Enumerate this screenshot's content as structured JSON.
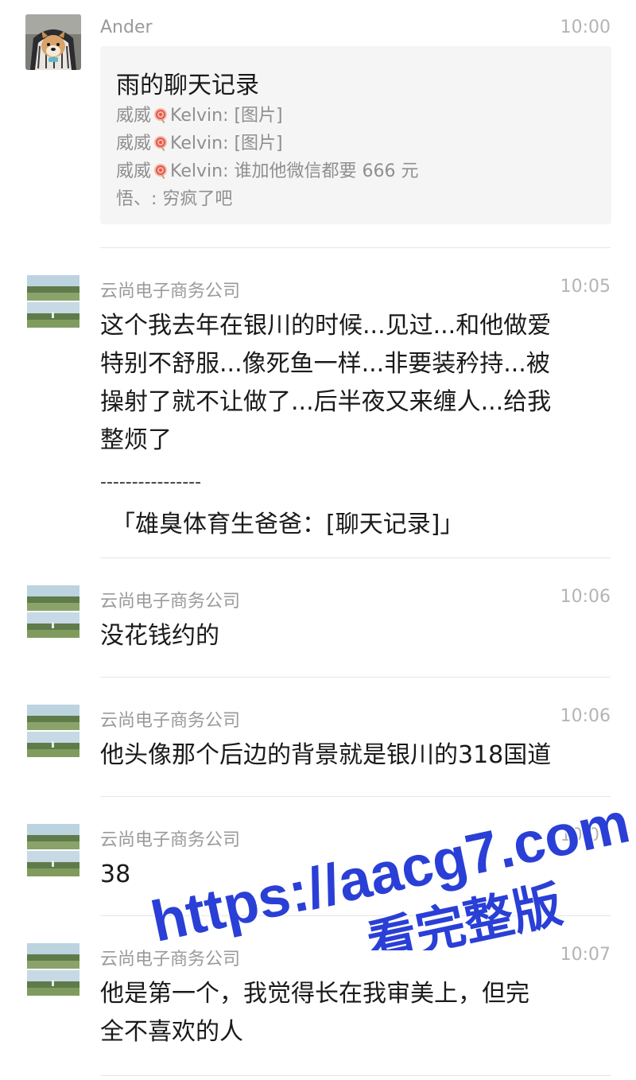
{
  "messages": [
    {
      "sender": "Ander",
      "time": "10:00",
      "avatar": "shiba-dog-avatar",
      "chat_record": {
        "title": "雨的聊天记录",
        "lines": [
          {
            "name": "威威",
            "rest": "Kelvin: [图片]"
          },
          {
            "name": "威威",
            "rest": "Kelvin: [图片]"
          },
          {
            "name": "威威",
            "rest": "Kelvin: 谁加他微信都要 666 元"
          },
          {
            "text": "悟、: 穷疯了吧"
          }
        ]
      }
    },
    {
      "sender": "云尚电子商务公司",
      "time": "10:05",
      "avatar": "landscape-avatar",
      "lines": [
        "这个我去年在银川的时候...见过...和他做爱",
        "特别不舒服...像死鱼一样...非要装矜持...被",
        "操射了就不让做了...后半夜又来缠人...给我",
        "整烦了"
      ],
      "separator": "----------------",
      "quote": "「雄臭体育生爸爸：[聊天记录]」"
    },
    {
      "sender": "云尚电子商务公司",
      "time": "10:06",
      "avatar": "landscape-avatar",
      "lines": [
        "没花钱约的"
      ]
    },
    {
      "sender": "云尚电子商务公司",
      "time": "10:06",
      "avatar": "landscape-avatar",
      "lines": [
        "他头像那个后边的背景就是银川的318国道"
      ]
    },
    {
      "sender": "云尚电子商务公司",
      "time": "10:07",
      "avatar": "landscape-avatar",
      "lines": [
        "38"
      ]
    },
    {
      "sender": "云尚电子商务公司",
      "time": "10:07",
      "avatar": "landscape-avatar",
      "lines": [
        "他是第一个，我觉得长在我审美上，但完",
        "全不喜欢的人"
      ]
    }
  ],
  "watermark": {
    "line1": "https://aacg7.com",
    "line2": "看完整版",
    "color": "#2a3fd6"
  },
  "colors": {
    "sender": "#9a9a9a",
    "time": "#b4b4b4",
    "text": "#1a1a1a",
    "card_bg": "#f5f5f5"
  }
}
